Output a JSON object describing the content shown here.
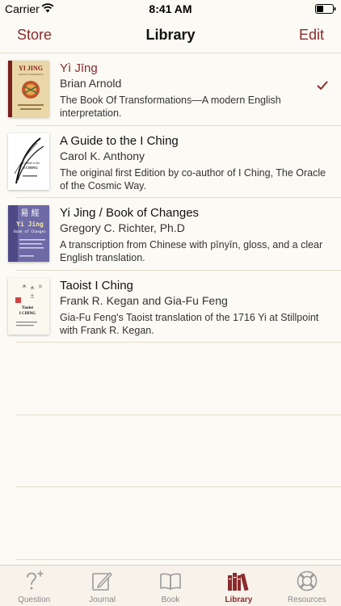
{
  "status": {
    "carrier": "Carrier",
    "time": "8:41 AM"
  },
  "nav": {
    "store_label": "Store",
    "title": "Library",
    "edit_label": "Edit"
  },
  "books": [
    {
      "title": "Yì Jīng",
      "author": "Brian Arnold",
      "description": "The Book Of Transformations—A modern English interpretation.",
      "selected": true,
      "cover": {
        "line1": "YI JING",
        "line2": "The Book of Transformations"
      }
    },
    {
      "title": "A Guide to the I Ching",
      "author": "Carol K. Anthony",
      "description": "The original first Edition by co-author of I Ching, The Oracle of the Cosmic Way.",
      "selected": false,
      "cover": {
        "line1": "A Guide to the",
        "line2": "I CHING"
      }
    },
    {
      "title": "Yi Jing / Book of Changes",
      "author": "Gregory C. Richter, Ph.D",
      "description": "A transcription from Chinese with pīnyīn, gloss, and a clear English translation.",
      "selected": false,
      "cover": {
        "line1": "易 經",
        "line2": "Yi Jing",
        "line3": "Book of Changes"
      }
    },
    {
      "title": "Taoist I Ching",
      "author": "Frank R. Kegan and Gia-Fu Feng",
      "description": "Gia-Fu Feng's Taoist translation of the 1716 Yi at Stillpoint with Frank R. Kegan.",
      "selected": false,
      "cover": {
        "line1": "Taoist",
        "line2": "I CHING"
      }
    }
  ],
  "tabs": [
    {
      "label": "Question",
      "icon": "question-icon",
      "active": false
    },
    {
      "label": "Journal",
      "icon": "journal-icon",
      "active": false
    },
    {
      "label": "Book",
      "icon": "book-icon",
      "active": false
    },
    {
      "label": "Library",
      "icon": "library-icon",
      "active": true
    },
    {
      "label": "Resources",
      "icon": "lifebuoy-icon",
      "active": false
    }
  ],
  "colors": {
    "accent": "#8b2a2c",
    "background": "#fcfaf4",
    "separator": "#e4ddcf"
  }
}
